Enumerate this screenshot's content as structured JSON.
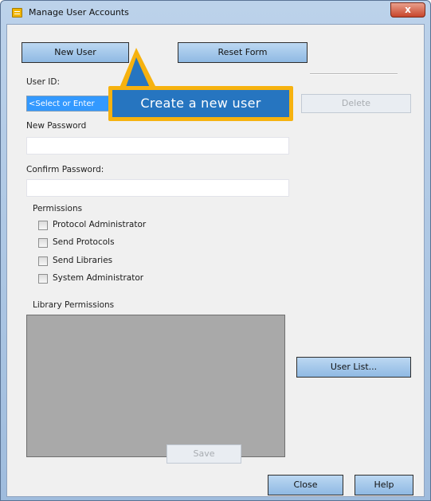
{
  "window": {
    "title": "Manage User Accounts",
    "close_glyph": "x"
  },
  "toolbar": {
    "new_user_label": "New User",
    "reset_form_label": "Reset Form"
  },
  "form": {
    "user_id_label": "User ID:",
    "user_id_value": "<Select or Enter",
    "delete_label": "Delete",
    "new_password_label": "New Password",
    "confirm_password_label": "Confirm Password:"
  },
  "permissions": {
    "title": "Permissions",
    "items": [
      {
        "label": "Protocol Administrator",
        "checked": false
      },
      {
        "label": "Send Protocols",
        "checked": false
      },
      {
        "label": "Send Libraries",
        "checked": false
      },
      {
        "label": "System Administrator",
        "checked": false
      }
    ]
  },
  "library": {
    "title": "Library Permissions",
    "user_list_label": "User List..."
  },
  "footer": {
    "save_label": "Save",
    "close_label": "Close",
    "help_label": "Help"
  },
  "callout": {
    "text": "Create a new user"
  },
  "colors": {
    "callout_border": "#f6b20f",
    "callout_fill": "#2675c0",
    "button_fill": "#9fc3ea",
    "selection": "#3399ff"
  }
}
